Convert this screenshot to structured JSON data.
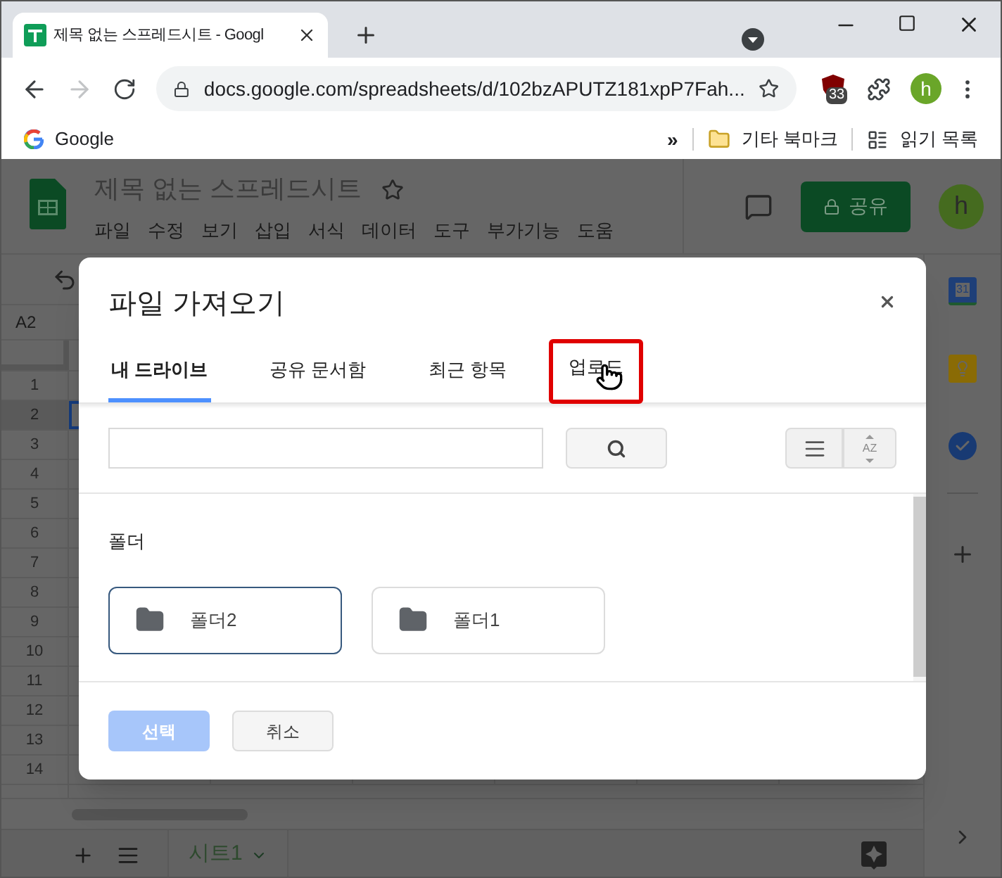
{
  "browser": {
    "tab_title": "제목 없는 스프레드시트 - Googl",
    "forward_enabled": false,
    "url": "docs.google.com/spreadsheets/d/102bzAPUTZ181xpP7Fah...",
    "extension_badge": "33",
    "profile_initial": "h",
    "bookmarks": [
      {
        "label": "Google"
      }
    ],
    "overflow": "»",
    "other_bookmarks": "기타 북마크",
    "reading_list": "읽기 목록"
  },
  "sheets": {
    "title": "제목 없는 스프레드시트",
    "menus": [
      "파일",
      "수정",
      "보기",
      "삽입",
      "서식",
      "데이터",
      "도구",
      "부가기능",
      "도움"
    ],
    "share": "공유",
    "account_initial": "h",
    "name_box": "A2",
    "rows": [
      {
        "label": "1",
        "selected": false
      },
      {
        "label": "2",
        "selected": true
      },
      {
        "label": "3",
        "selected": false
      },
      {
        "label": "4",
        "selected": false
      },
      {
        "label": "5",
        "selected": false
      },
      {
        "label": "6",
        "selected": false
      },
      {
        "label": "7",
        "selected": false
      },
      {
        "label": "8",
        "selected": false
      },
      {
        "label": "9",
        "selected": false
      },
      {
        "label": "10",
        "selected": false
      },
      {
        "label": "11",
        "selected": false
      },
      {
        "label": "12",
        "selected": false
      },
      {
        "label": "13",
        "selected": false
      },
      {
        "label": "14",
        "selected": false
      }
    ],
    "sheet_tab": "시트1",
    "calendar_day": "31"
  },
  "dialog": {
    "title": "파일 가져오기",
    "tabs": [
      {
        "label": "내 드라이브",
        "selected": true,
        "highlighted": false
      },
      {
        "label": "공유 문서함",
        "selected": false,
        "highlighted": false
      },
      {
        "label": "최근 항목",
        "selected": false,
        "highlighted": false
      },
      {
        "label": "업로드",
        "selected": false,
        "highlighted": true
      }
    ],
    "sort_glyph": "AZ",
    "section": "폴더",
    "folders": [
      {
        "name": "폴더2",
        "selected": true
      },
      {
        "name": "폴더1",
        "selected": false
      }
    ],
    "buttons": [
      {
        "label": "선택",
        "kind": "primary",
        "disabled": true
      },
      {
        "label": "취소",
        "kind": "secondary",
        "disabled": false
      }
    ]
  }
}
